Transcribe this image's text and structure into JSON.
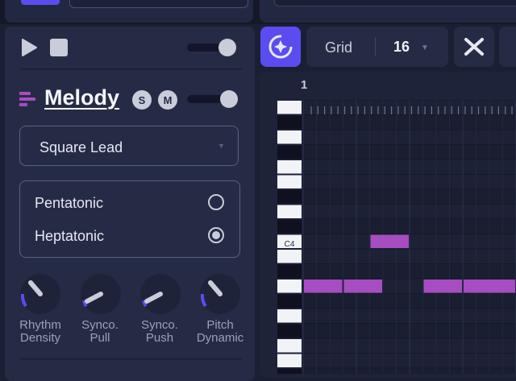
{
  "track": {
    "name": "Melody",
    "solo_label": "S",
    "mute_label": "M",
    "instrument": "Square Lead",
    "scales": [
      {
        "label": "Pentatonic",
        "selected": false
      },
      {
        "label": "Heptatonic",
        "selected": true
      }
    ],
    "knobs": [
      {
        "label_line1": "Rhythm",
        "label_line2": "Density",
        "value": 0.35
      },
      {
        "label_line1": "Synco.",
        "label_line2": "Pull",
        "value": 0.2
      },
      {
        "label_line1": "Synco.",
        "label_line2": "Push",
        "value": 0.2
      },
      {
        "label_line1": "Pitch",
        "label_line2": "Dynamic",
        "value": 0.35
      }
    ]
  },
  "toolbar": {
    "grid_label": "Grid",
    "grid_value": "16"
  },
  "piano_roll": {
    "bar_number": "1",
    "c4_label": "C4",
    "notes": [
      {
        "pitch": "C4",
        "start_step": 5,
        "length_steps": 3
      },
      {
        "pitch": "A3",
        "start_step": 0,
        "length_steps": 3
      },
      {
        "pitch": "A3",
        "start_step": 3,
        "length_steps": 3
      },
      {
        "pitch": "A3",
        "start_step": 9,
        "length_steps": 3
      },
      {
        "pitch": "A3",
        "start_step": 12,
        "length_steps": 4
      }
    ]
  },
  "colors": {
    "accent": "#5b4cf0",
    "note": "#a64dc2",
    "knob_arc": "#5b4cf0"
  },
  "icons": [
    "play-icon",
    "stop-icon",
    "track-bars-icon",
    "sparkle-magic-icon",
    "chevron-down-icon",
    "crossing-arrows-icon"
  ]
}
